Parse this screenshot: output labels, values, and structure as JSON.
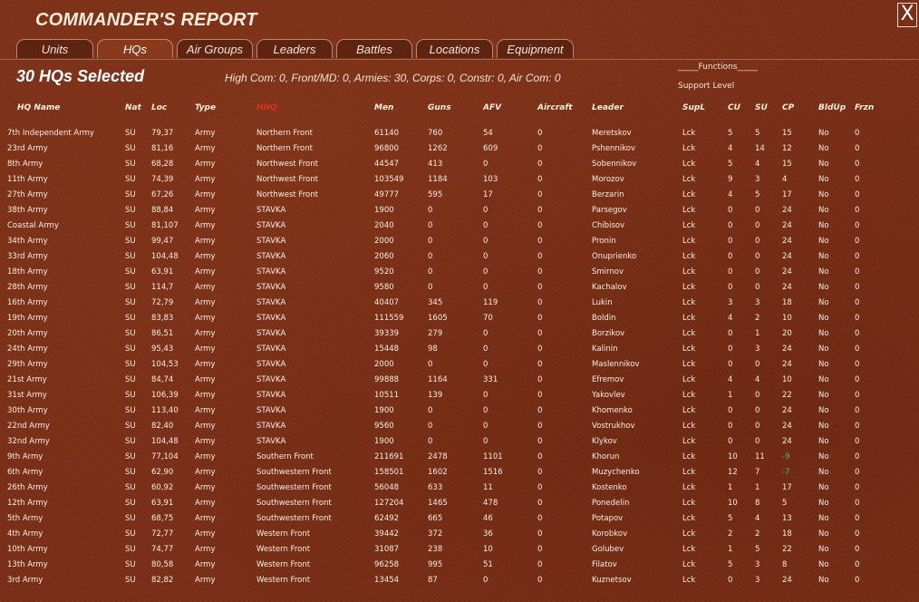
{
  "window": {
    "title": "COMMANDER'S REPORT",
    "close_label": "X"
  },
  "tabs": [
    "Units",
    "HQs",
    "Air Groups",
    "Leaders",
    "Battles",
    "Locations",
    "Equipment"
  ],
  "active_tab": "HQs",
  "selection": {
    "count_text": "30 HQs Selected",
    "summary": "High Com: 0, Front/MD: 0, Armies: 30, Corps: 0, Constr: 0, Air Com: 0"
  },
  "functions_label": "_____Functions_____",
  "support_level_label": "Support Level",
  "columns": [
    "HQ Name",
    "Nat",
    "Loc",
    "Type",
    "HHQ",
    "Men",
    "Guns",
    "AFV",
    "Aircraft",
    "Leader",
    "SupL",
    "CU",
    "SU",
    "CP",
    "BldUp",
    "Frzn"
  ],
  "sorted_column": "HHQ",
  "colors": {
    "background": "#7a2f16",
    "sorted_header": "#e0301c",
    "negative_cp": "#37c86a"
  },
  "rows": [
    [
      "7th Independent Army",
      "SU",
      "79,37",
      "Army",
      "Northern Front",
      "61140",
      "760",
      "54",
      "0",
      "Meretskov",
      "Lck",
      "5",
      "5",
      "15",
      "No",
      "0"
    ],
    [
      "23rd Army",
      "SU",
      "81,16",
      "Army",
      "Northern Front",
      "96800",
      "1262",
      "609",
      "0",
      "Pshennikov",
      "Lck",
      "4",
      "14",
      "12",
      "No",
      "0"
    ],
    [
      "8th Army",
      "SU",
      "68,28",
      "Army",
      "Northwest Front",
      "44547",
      "413",
      "0",
      "0",
      "Sobennikov",
      "Lck",
      "5",
      "4",
      "15",
      "No",
      "0"
    ],
    [
      "11th Army",
      "SU",
      "74,39",
      "Army",
      "Northwest Front",
      "103549",
      "1184",
      "103",
      "0",
      "Morozov",
      "Lck",
      "9",
      "3",
      "4",
      "No",
      "0"
    ],
    [
      "27th Army",
      "SU",
      "67,26",
      "Army",
      "Northwest Front",
      "49777",
      "595",
      "17",
      "0",
      "Berzarin",
      "Lck",
      "4",
      "5",
      "17",
      "No",
      "0"
    ],
    [
      "38th Army",
      "SU",
      "88,84",
      "Army",
      "STAVKA",
      "1900",
      "0",
      "0",
      "0",
      "Parsegov",
      "Lck",
      "0",
      "0",
      "24",
      "No",
      "0"
    ],
    [
      "Coastal Army",
      "SU",
      "81,107",
      "Army",
      "STAVKA",
      "2040",
      "0",
      "0",
      "0",
      "Chibisov",
      "Lck",
      "0",
      "0",
      "24",
      "No",
      "0"
    ],
    [
      "34th Army",
      "SU",
      "99,47",
      "Army",
      "STAVKA",
      "2000",
      "0",
      "0",
      "0",
      "Pronin",
      "Lck",
      "0",
      "0",
      "24",
      "No",
      "0"
    ],
    [
      "33rd Army",
      "SU",
      "104,48",
      "Army",
      "STAVKA",
      "2060",
      "0",
      "0",
      "0",
      "Onuprienko",
      "Lck",
      "0",
      "0",
      "24",
      "No",
      "0"
    ],
    [
      "18th Army",
      "SU",
      "63,91",
      "Army",
      "STAVKA",
      "9520",
      "0",
      "0",
      "0",
      "Smirnov",
      "Lck",
      "0",
      "0",
      "24",
      "No",
      "0"
    ],
    [
      "28th Army",
      "SU",
      "114,7",
      "Army",
      "STAVKA",
      "9580",
      "0",
      "0",
      "0",
      "Kachalov",
      "Lck",
      "0",
      "0",
      "24",
      "No",
      "0"
    ],
    [
      "16th Army",
      "SU",
      "72,79",
      "Army",
      "STAVKA",
      "40407",
      "345",
      "119",
      "0",
      "Lukin",
      "Lck",
      "3",
      "3",
      "18",
      "No",
      "0"
    ],
    [
      "19th Army",
      "SU",
      "83,83",
      "Army",
      "STAVKA",
      "111559",
      "1605",
      "70",
      "0",
      "Boldin",
      "Lck",
      "4",
      "2",
      "10",
      "No",
      "0"
    ],
    [
      "20th Army",
      "SU",
      "86,51",
      "Army",
      "STAVKA",
      "39339",
      "279",
      "0",
      "0",
      "Borzikov",
      "Lck",
      "0",
      "1",
      "20",
      "No",
      "0"
    ],
    [
      "24th Army",
      "SU",
      "95,43",
      "Army",
      "STAVKA",
      "15448",
      "98",
      "0",
      "0",
      "Kalinin",
      "Lck",
      "0",
      "3",
      "24",
      "No",
      "0"
    ],
    [
      "29th Army",
      "SU",
      "104,53",
      "Army",
      "STAVKA",
      "2000",
      "0",
      "0",
      "0",
      "Maslennikov",
      "Lck",
      "0",
      "0",
      "24",
      "No",
      "0"
    ],
    [
      "21st Army",
      "SU",
      "84,74",
      "Army",
      "STAVKA",
      "99888",
      "1164",
      "331",
      "0",
      "Efremov",
      "Lck",
      "4",
      "4",
      "10",
      "No",
      "0"
    ],
    [
      "31st Army",
      "SU",
      "106,39",
      "Army",
      "STAVKA",
      "10511",
      "139",
      "0",
      "0",
      "Yakovlev",
      "Lck",
      "1",
      "0",
      "22",
      "No",
      "0"
    ],
    [
      "30th Army",
      "SU",
      "113,40",
      "Army",
      "STAVKA",
      "1900",
      "0",
      "0",
      "0",
      "Khomenko",
      "Lck",
      "0",
      "0",
      "24",
      "No",
      "0"
    ],
    [
      "22nd Army",
      "SU",
      "82,40",
      "Army",
      "STAVKA",
      "9560",
      "0",
      "0",
      "0",
      "Vostrukhov",
      "Lck",
      "0",
      "0",
      "24",
      "No",
      "0"
    ],
    [
      "32nd Army",
      "SU",
      "104,48",
      "Army",
      "STAVKA",
      "1900",
      "0",
      "0",
      "0",
      "Klykov",
      "Lck",
      "0",
      "0",
      "24",
      "No",
      "0"
    ],
    [
      "9th Army",
      "SU",
      "77,104",
      "Army",
      "Southern Front",
      "211691",
      "2478",
      "1101",
      "0",
      "Khorun",
      "Lck",
      "10",
      "11",
      "-9",
      "No",
      "0"
    ],
    [
      "6th Army",
      "SU",
      "62,90",
      "Army",
      "Southwestern Front",
      "158501",
      "1602",
      "1516",
      "0",
      "Muzychenko",
      "Lck",
      "12",
      "7",
      "-7",
      "No",
      "0"
    ],
    [
      "26th Army",
      "SU",
      "60,92",
      "Army",
      "Southwestern Front",
      "56048",
      "633",
      "11",
      "0",
      "Kostenko",
      "Lck",
      "1",
      "1",
      "17",
      "No",
      "0"
    ],
    [
      "12th Army",
      "SU",
      "63,91",
      "Army",
      "Southwestern Front",
      "127204",
      "1465",
      "478",
      "0",
      "Ponedelin",
      "Lck",
      "10",
      "8",
      "5",
      "No",
      "0"
    ],
    [
      "5th Army",
      "SU",
      "68,75",
      "Army",
      "Southwestern Front",
      "62492",
      "665",
      "46",
      "0",
      "Potapov",
      "Lck",
      "5",
      "4",
      "13",
      "No",
      "0"
    ],
    [
      "4th Army",
      "SU",
      "72,77",
      "Army",
      "Western Front",
      "39442",
      "372",
      "36",
      "0",
      "Korobkov",
      "Lck",
      "2",
      "2",
      "18",
      "No",
      "0"
    ],
    [
      "10th Army",
      "SU",
      "74,77",
      "Army",
      "Western Front",
      "31087",
      "238",
      "10",
      "0",
      "Golubev",
      "Lck",
      "1",
      "5",
      "22",
      "No",
      "0"
    ],
    [
      "13th Army",
      "SU",
      "80,58",
      "Army",
      "Western Front",
      "96258",
      "995",
      "51",
      "0",
      "Filatov",
      "Lck",
      "5",
      "3",
      "8",
      "No",
      "0"
    ],
    [
      "3rd Army",
      "SU",
      "82,82",
      "Army",
      "Western Front",
      "13454",
      "87",
      "0",
      "0",
      "Kuznetsov",
      "Lck",
      "0",
      "3",
      "24",
      "No",
      "0"
    ]
  ]
}
